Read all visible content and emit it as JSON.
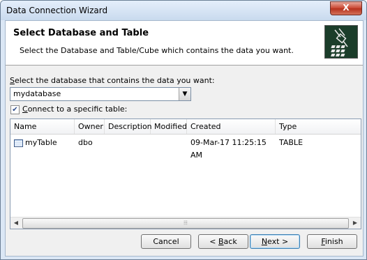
{
  "window": {
    "title": "Data Connection Wizard",
    "close_label": "X"
  },
  "header": {
    "title": "Select Database and Table",
    "subtitle": "Select the Database and Table/Cube which contains the data you want."
  },
  "database": {
    "label_first": "S",
    "label_rest": "elect the database that contains the data you want:",
    "value": "mydatabase"
  },
  "connect": {
    "checked": true,
    "label_first": "C",
    "label_rest": "onnect to a specific table:"
  },
  "table": {
    "columns": [
      "Name",
      "Owner",
      "Description",
      "Modified",
      "Created",
      "Type"
    ],
    "rows": [
      {
        "name": "myTable",
        "owner": "dbo",
        "description": "",
        "modified": "",
        "created": "09-Mar-17 11:25:15 AM",
        "type": "TABLE"
      }
    ]
  },
  "buttons": {
    "cancel": "Cancel",
    "back_prefix": "< ",
    "back_accel": "B",
    "back_rest": "ack",
    "next_accel": "N",
    "next_rest": "ext >",
    "finish_accel": "F",
    "finish_rest": "inish"
  }
}
